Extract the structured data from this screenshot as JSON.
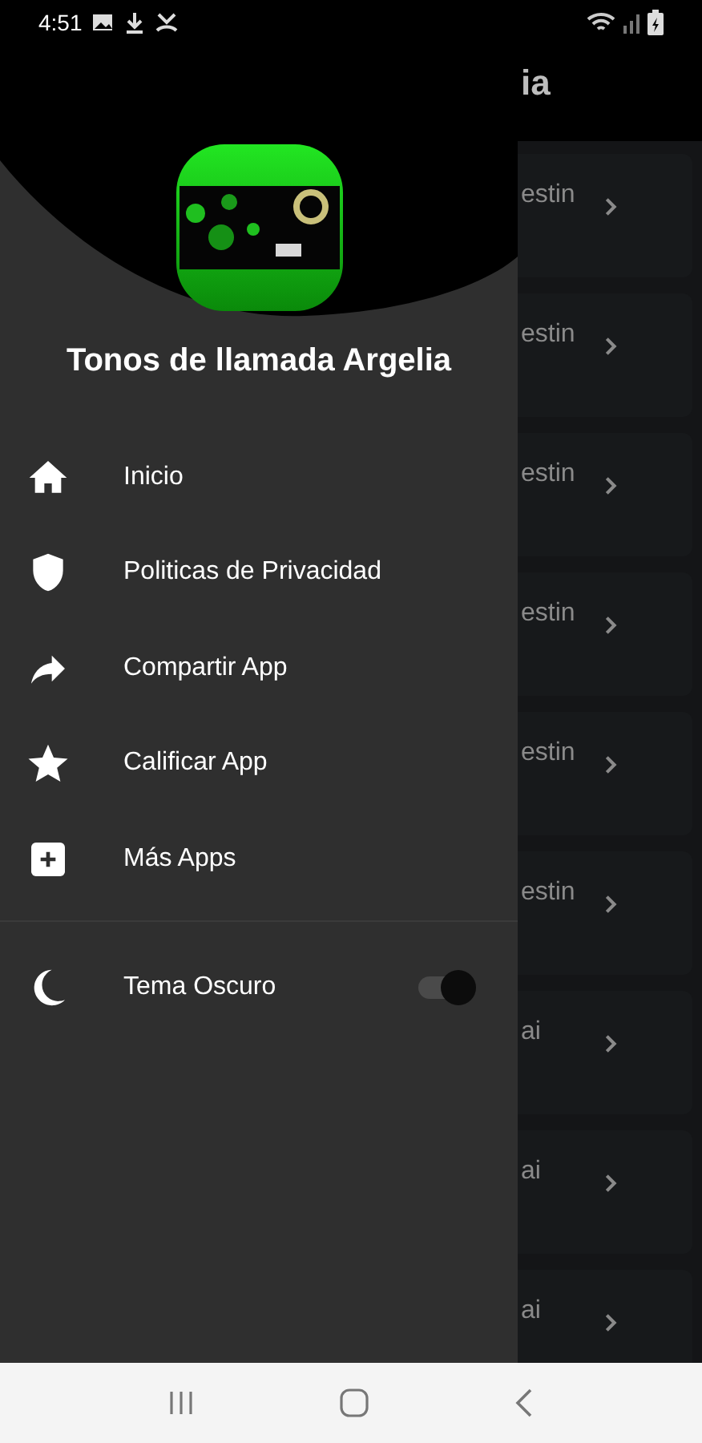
{
  "status_bar": {
    "time": "4:51"
  },
  "app_bar": {
    "title": "ia"
  },
  "cards": [
    {
      "title": "estin"
    },
    {
      "title": "estin"
    },
    {
      "title": "estin"
    },
    {
      "title": "estin"
    },
    {
      "title": "estin"
    },
    {
      "title": "estin"
    },
    {
      "title": "ai"
    },
    {
      "title": "ai"
    },
    {
      "title": "ai"
    }
  ],
  "drawer": {
    "title": "Tonos de llamada Argelia",
    "items": [
      {
        "kind": "home",
        "label": "Inicio"
      },
      {
        "kind": "shield",
        "label": "Politicas de Privacidad"
      },
      {
        "kind": "share",
        "label": "Compartir App"
      },
      {
        "kind": "star",
        "label": "Calificar App"
      },
      {
        "kind": "plus",
        "label": "Más Apps"
      }
    ],
    "dark_theme": {
      "label": "Tema Oscuro",
      "on": true
    }
  }
}
